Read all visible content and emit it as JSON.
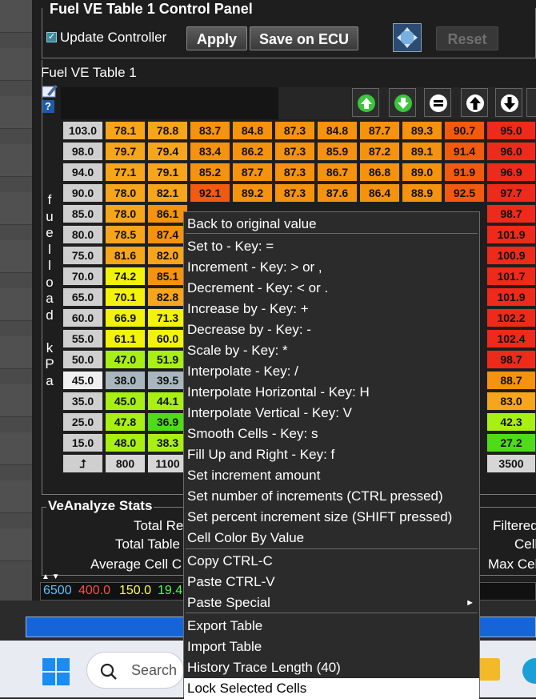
{
  "panel": {
    "title": "Fuel VE Table 1 Control Panel",
    "update_controller_label": "Update Controller",
    "update_controller_checked": true,
    "apply_label": "Apply",
    "save_label": "Save on ECU",
    "reset_label": "Reset"
  },
  "table": {
    "title": "Fuel VE Table 1",
    "y_axis_label": [
      "f",
      "u",
      "e",
      "l",
      "l",
      "o",
      "a",
      "d",
      "",
      "k",
      "P",
      "a"
    ],
    "y_axis": [
      "103.0",
      "98.0",
      "94.0",
      "90.0",
      "85.0",
      "80.0",
      "75.0",
      "70.0",
      "65.0",
      "60.0",
      "55.0",
      "50.0",
      "45.0",
      "35.0",
      "25.0",
      "15.0"
    ],
    "x_axis_visible": [
      "800",
      "1100",
      "3500"
    ],
    "rows": [
      [
        "78.1",
        "78.8",
        "83.7",
        "84.8",
        "87.3",
        "84.8",
        "87.7",
        "89.3",
        "90.7",
        "95.0"
      ],
      [
        "79.7",
        "79.4",
        "83.4",
        "86.2",
        "87.3",
        "85.9",
        "87.2",
        "89.1",
        "91.4",
        "96.0"
      ],
      [
        "77.1",
        "79.1",
        "85.2",
        "87.7",
        "87.3",
        "86.7",
        "86.8",
        "89.0",
        "91.9",
        "96.9"
      ],
      [
        "78.0",
        "82.1",
        "92.1",
        "89.2",
        "87.3",
        "87.6",
        "86.4",
        "88.9",
        "92.5",
        "97.7"
      ],
      [
        "78.0",
        "86.1",
        "",
        "",
        "",
        "",
        "",
        "",
        "",
        "98.7"
      ],
      [
        "78.5",
        "87.4",
        "",
        "",
        "",
        "",
        "",
        "",
        "",
        "101.9"
      ],
      [
        "81.6",
        "82.0",
        "",
        "",
        "",
        "",
        "",
        "",
        "",
        "100.9"
      ],
      [
        "74.2",
        "85.1",
        "",
        "",
        "",
        "",
        "",
        "",
        "",
        "101.7"
      ],
      [
        "70.1",
        "82.8",
        "",
        "",
        "",
        "",
        "",
        "",
        "",
        "101.9"
      ],
      [
        "66.9",
        "71.3",
        "",
        "",
        "",
        "",
        "",
        "",
        "",
        "102.2"
      ],
      [
        "61.1",
        "60.0",
        "",
        "",
        "",
        "",
        "",
        "",
        "",
        "102.4"
      ],
      [
        "47.0",
        "51.9",
        "",
        "",
        "",
        "",
        "",
        "",
        "",
        "98.7"
      ],
      [
        "38.0",
        "39.5",
        "",
        "",
        "",
        "",
        "",
        "",
        "",
        "88.7"
      ],
      [
        "45.0",
        "44.1",
        "",
        "",
        "",
        "",
        "",
        "",
        "",
        "83.0"
      ],
      [
        "47.8",
        "36.9",
        "",
        "",
        "",
        "",
        "",
        "",
        "",
        "42.3"
      ],
      [
        "48.0",
        "38.3",
        "",
        "",
        "",
        "",
        "",
        "",
        "",
        "27.2"
      ]
    ],
    "colors": {
      "deep_red": "#ee2a1a",
      "red_orange": "#f25a10",
      "orange": "#f5920e",
      "light_orange": "#f7a51a",
      "yellow": "#f3f30a",
      "lime": "#a8ef14",
      "green": "#4fdc18",
      "gray_blue": "#a9b6bd"
    },
    "nav_icons": [
      "move-up-icon",
      "move-down-icon",
      "equals-icon",
      "arrow-up-icon",
      "arrow-down-icon"
    ]
  },
  "context_menu": {
    "items": [
      {
        "label": "Back to original value"
      },
      {
        "label": "Set to - Key: ="
      },
      {
        "label": "Increment - Key: > or ,"
      },
      {
        "label": "Decrement - Key: < or ."
      },
      {
        "label": "Increase by - Key: +"
      },
      {
        "label": "Decrease by - Key: -"
      },
      {
        "label": "Scale by - Key: *"
      },
      {
        "label": "Interpolate - Key: /"
      },
      {
        "label": "Interpolate Horizontal - Key: H"
      },
      {
        "label": "Interpolate Vertical - Key: V"
      },
      {
        "label": "Smooth Cells - Key: s"
      },
      {
        "label": "Fill Up and Right - Key: f"
      },
      {
        "label": "Set increment amount"
      },
      {
        "label": "Set number of increments (CTRL pressed)"
      },
      {
        "label": "Set percent increment size (SHIFT pressed)"
      },
      {
        "label": "Cell Color By Value"
      },
      {
        "label": "Copy CTRL-C"
      },
      {
        "label": "Paste CTRL-V"
      },
      {
        "label": "Paste Special"
      },
      {
        "label": "Export Table"
      },
      {
        "label": "Import Table"
      },
      {
        "label": "History Trace Length (40)"
      },
      {
        "label": "Lock Selected Cells"
      }
    ]
  },
  "stats": {
    "title": "VeAnalyze Stats",
    "total_re": "Total Re",
    "total_table": "Total Table",
    "average_cell": "Average Cell C",
    "filtered": "Filtered",
    "cell": "Cell",
    "max_cell": "Max Cell"
  },
  "status_values": {
    "v1": "6500",
    "v2": "400.0",
    "v3": "150.0",
    "v4": "19.4"
  },
  "taskbar": {
    "search_placeholder": "Search"
  }
}
